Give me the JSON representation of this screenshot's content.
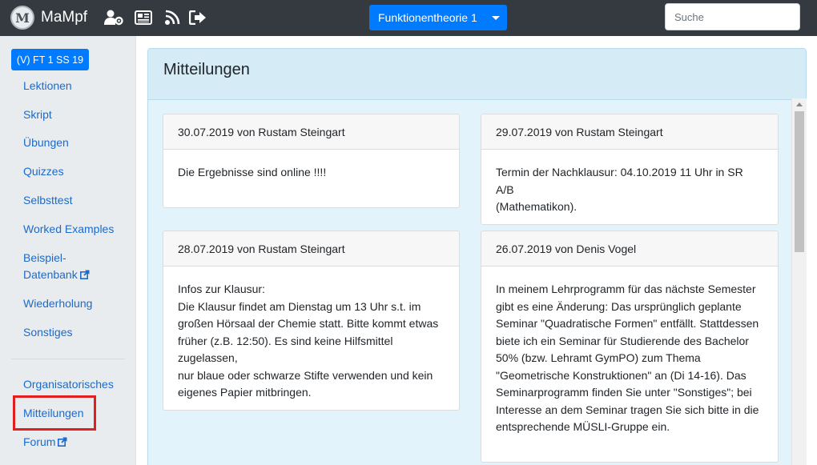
{
  "navbar": {
    "brand": "MaMpf",
    "logo_letter": "M",
    "icons": [
      "user-settings-icon",
      "news-icon",
      "feed-icon",
      "logout-icon"
    ],
    "lecture_button": "Funktionentheorie 1",
    "search_placeholder": "Suche"
  },
  "sidebar": {
    "course_badge": "(V) FT 1 SS 19",
    "items": [
      {
        "label": "Lektionen"
      },
      {
        "label": "Skript"
      },
      {
        "label": "Übungen"
      },
      {
        "label": "Quizzes"
      },
      {
        "label": "Selbsttest"
      },
      {
        "label": "Worked Examples"
      },
      {
        "label": "Beispiel-"
      },
      {
        "label": "Datenbank",
        "external": true
      },
      {
        "label": "Wiederholung"
      },
      {
        "label": "Sonstiges"
      },
      {
        "label": "Organisatorisches"
      },
      {
        "label": "Mitteilungen",
        "highlighted": true
      },
      {
        "label": "Forum",
        "external": true
      }
    ]
  },
  "main": {
    "title": "Mitteilungen",
    "announcements": [
      {
        "header": "30.07.2019 von Rustam Steingart",
        "lines": [
          "Die Ergebnisse sind online !!!!"
        ]
      },
      {
        "header": "29.07.2019 von Rustam Steingart",
        "lines": [
          "Termin der Nachklausur: 04.10.2019 11 Uhr in SR A/B",
          "(Mathematikon)."
        ]
      },
      {
        "header": "28.07.2019 von Rustam Steingart",
        "lines": [
          "Infos zur Klausur:",
          "Die Klausur findet am Dienstag um 13 Uhr s.t. im",
          "großen Hörsaal der Chemie statt. Bitte kommt etwas",
          "früher (z.B. 12:50). Es sind keine Hilfsmittel zugelassen,",
          "nur blaue oder schwarze Stifte verwenden und kein",
          "eigenes Papier mitbringen."
        ]
      },
      {
        "header": "26.07.2019 von Denis Vogel",
        "lines": [
          "In meinem Lehrprogramm für das nächste Semester",
          "gibt es eine Änderung: Das ursprünglich geplante",
          "Seminar \"Quadratische Formen\" entfällt. Stattdessen",
          "biete ich ein Seminar für Studierende des Bachelor",
          "50% (bzw. Lehramt GymPO) zum Thema",
          "\"Geometrische Konstruktionen\" an (Di 14-16). Das",
          "Seminarprogramm finden Sie unter \"Sonstiges\"; bei",
          "Interesse an dem Seminar tragen Sie sich bitte in die",
          "entsprechende MÜSLI-Gruppe ein."
        ]
      }
    ]
  },
  "colors": {
    "navbar": "#343a40",
    "accent": "#007bff",
    "link": "#1c6ac9",
    "highlight": "#e0201f",
    "panel": "#e2f3fb"
  }
}
